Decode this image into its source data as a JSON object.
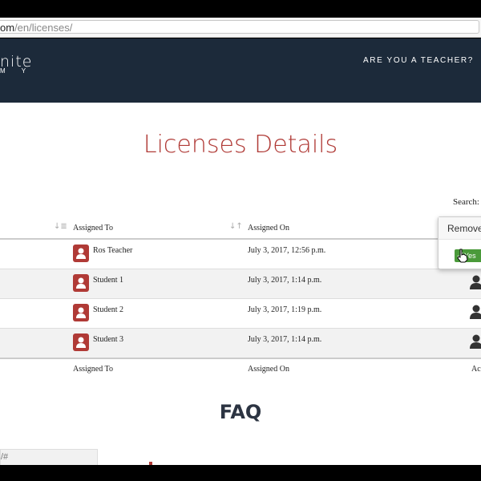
{
  "browser": {
    "url_prefix": "om",
    "url_path": "/en/licenses/"
  },
  "header": {
    "logo_top": "nite",
    "logo_bottom": "M Y",
    "teacher_link": "ARE YOU A TEACHER?"
  },
  "page_title": "Licenses Details",
  "search_label": "Search:",
  "table": {
    "columns": [
      "Assigned To",
      "Assigned On"
    ],
    "footer_columns": [
      "Assigned To",
      "Assigned On",
      "Ac"
    ],
    "rows": [
      {
        "name": "Ros Teacher",
        "date": "July 3, 2017, 12:56 p.m."
      },
      {
        "name": "Student 1",
        "date": "July 3, 2017, 1:14 p.m."
      },
      {
        "name": "Student 2",
        "date": "July 3, 2017, 1:19 p.m."
      },
      {
        "name": "Student 3",
        "date": "July 3, 2017, 1:14 p.m."
      }
    ]
  },
  "popover": {
    "title": "Remove",
    "yes_label": "Yes"
  },
  "faq_title": "FAQ",
  "status_url": "/#",
  "icons": {
    "avatar": "user-avatar-icon",
    "action": "user-icon",
    "sort": "sort-icon",
    "check": "check-icon",
    "cursor": "hand-cursor-icon"
  },
  "colors": {
    "brand_red": "#b03a36",
    "header_bg": "#1c2a3a",
    "yes_green": "#4a9a3a"
  }
}
